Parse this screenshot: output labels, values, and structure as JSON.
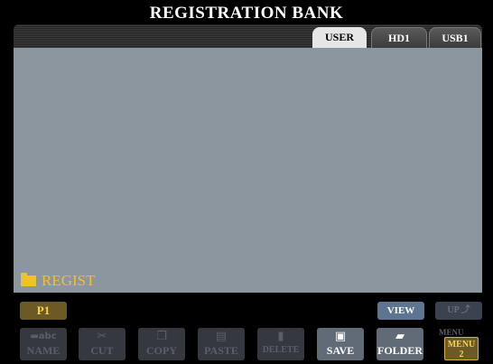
{
  "title": "REGISTRATION BANK",
  "tabs": [
    {
      "label": "USER",
      "active": true
    },
    {
      "label": "HD1",
      "active": false
    },
    {
      "label": "USB1",
      "active": false
    }
  ],
  "current_folder": "REGIST",
  "page_button": "P1",
  "view_button": "VIEW",
  "up_button": "UP",
  "functions": [
    {
      "label": "NAME",
      "icon": "abc-icon",
      "enabled": false
    },
    {
      "label": "CUT",
      "icon": "scissors-icon",
      "enabled": false
    },
    {
      "label": "COPY",
      "icon": "copy-icon",
      "enabled": false
    },
    {
      "label": "PASTE",
      "icon": "paste-icon",
      "enabled": false
    },
    {
      "label": "DELETE",
      "icon": "trash-icon",
      "enabled": false
    },
    {
      "label": "SAVE",
      "icon": "floppy-icon",
      "enabled": true
    },
    {
      "label": "FOLDER",
      "icon": "folder-icon",
      "enabled": true
    }
  ],
  "menu": {
    "faded_label": "MENU",
    "label_top": "MENU",
    "label_bottom": "2"
  },
  "colors": {
    "accent_yellow": "#f0c12a",
    "panel": "#8c969f"
  }
}
